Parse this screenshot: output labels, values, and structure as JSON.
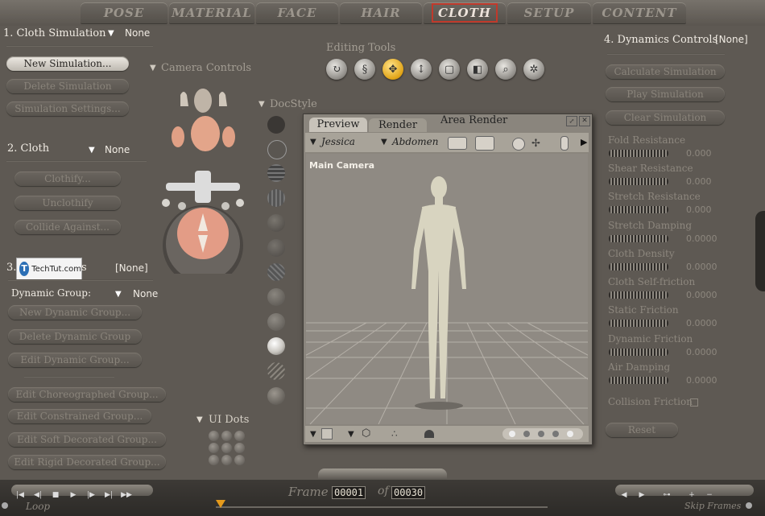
{
  "tabs": [
    "POSE",
    "MATERIAL",
    "FACE",
    "HAIR",
    "CLOTH",
    "SETUP",
    "CONTENT"
  ],
  "cloth_simulation": {
    "title": "1. Cloth Simulation",
    "value": "None",
    "buttons": [
      "New Simulation...",
      "Delete Simulation",
      "Simulation Settings..."
    ]
  },
  "cloth": {
    "title": "2. Cloth",
    "value": "None",
    "buttons": [
      "Clothify...",
      "Unclothify",
      "Collide Against..."
    ]
  },
  "section3": {
    "title_prefix": "3.",
    "title_suffix": "s",
    "value": "[None]",
    "watermark": "TechTut.com",
    "dynamic_group_label": "Dynamic Group:",
    "dynamic_group_value": "None",
    "buttons": [
      "New Dynamic Group...",
      "Delete Dynamic Group",
      "Edit Dynamic Group..."
    ],
    "group_buttons": [
      "Edit Choreographed Group...",
      "Edit Constrained Group...",
      "Edit Soft Decorated Group...",
      "Edit Rigid Decorated Group..."
    ]
  },
  "camera_controls_label": "Camera Controls",
  "editing_tools_label": "Editing Tools",
  "editing_tools_icons": [
    "rotate-icon",
    "twist-icon",
    "translate-icon",
    "translate-in-out-icon",
    "scale-icon",
    "taper-icon",
    "magnify-icon",
    "color-icon"
  ],
  "docstyle_label": "DocStyle",
  "ui_dots_label": "UI Dots",
  "render_window": {
    "tabs": [
      "Preview",
      "Render",
      "Area Render"
    ],
    "figure": "Jessica",
    "body_part": "Abdomen",
    "camera_label": "Main Camera"
  },
  "dynamics": {
    "title": "4. Dynamics Controls",
    "value": "[None]",
    "buttons": [
      "Calculate Simulation",
      "Play Simulation",
      "Clear Simulation"
    ],
    "params": [
      {
        "label": "Fold Resistance",
        "value": "0.000"
      },
      {
        "label": "Shear Resistance",
        "value": "0.000"
      },
      {
        "label": "Stretch Resistance",
        "value": "0.000"
      },
      {
        "label": "Stretch Damping",
        "value": "0.0000"
      },
      {
        "label": "Cloth Density",
        "value": "0.0000"
      },
      {
        "label": "Cloth Self-friction",
        "value": "0.0000"
      },
      {
        "label": "Static Friction",
        "value": "0.0000"
      },
      {
        "label": "Dynamic Friction",
        "value": "0.0000"
      },
      {
        "label": "Air Damping",
        "value": "0.0000"
      }
    ],
    "collision_friction": "Collision Friction",
    "reset": "Reset"
  },
  "timeline": {
    "loop": "Loop",
    "frame_label": "Frame",
    "frame_current": "00001",
    "of_label": "of",
    "frame_total": "00030",
    "skip_frames": "Skip Frames"
  }
}
